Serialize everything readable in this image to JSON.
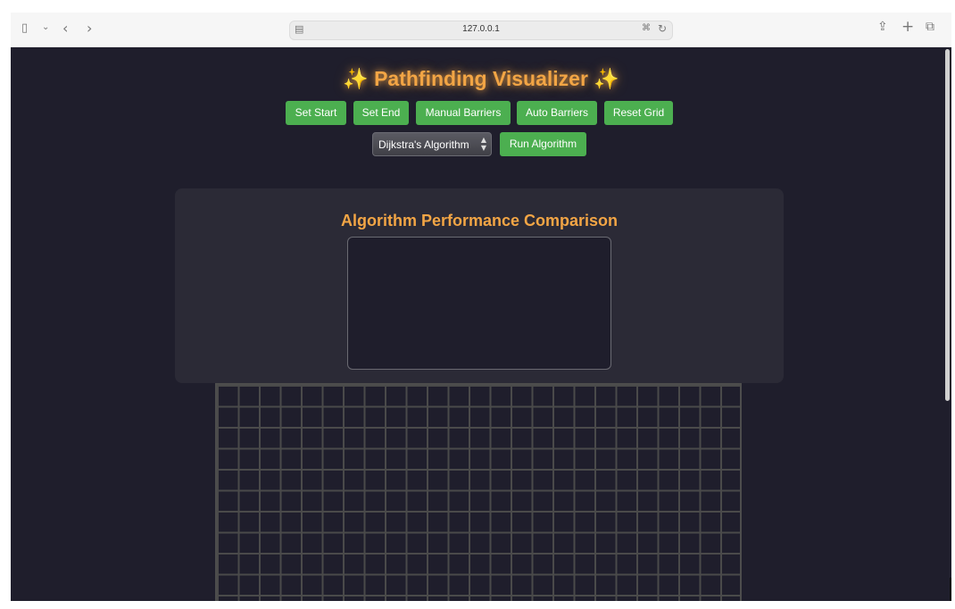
{
  "browser": {
    "url": "127.0.0.1",
    "icons": {
      "sidebar": "sidebar-icon",
      "back": "back-icon",
      "forward": "forward-icon",
      "share": "share-icon",
      "new_tab": "plus-icon",
      "tabs": "tabs-icon",
      "translate": "translate-icon",
      "reload": "reload-icon"
    }
  },
  "page": {
    "title": "✨ Pathfinding Visualizer ✨",
    "accent_color": "#f2a545",
    "button_color": "#4caf50",
    "background_color": "#1f1e2c"
  },
  "controls": {
    "buttons": [
      "Set Start",
      "Set End",
      "Manual Barriers",
      "Auto Barriers",
      "Reset Grid"
    ],
    "algorithm_selected": "Dijkstra's Algorithm",
    "run_label": "Run Algorithm"
  },
  "performance": {
    "title": "Algorithm Performance Comparison"
  }
}
